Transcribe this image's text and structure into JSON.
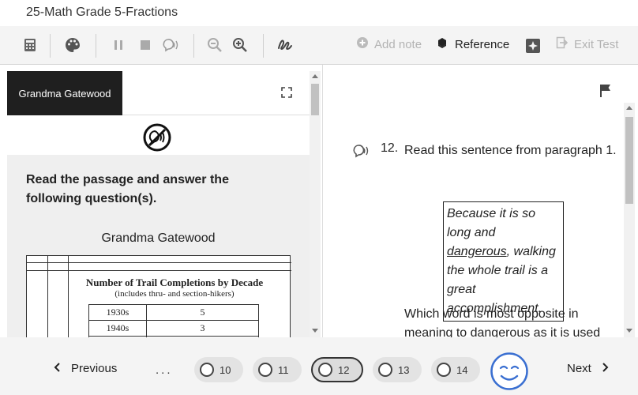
{
  "window": {
    "title": "25-Math Grade 5-Fractions"
  },
  "toolbar": {
    "tools": [
      {
        "name": "calculator-icon"
      },
      {
        "name": "palette-icon"
      },
      {
        "name": "pause-icon"
      },
      {
        "name": "stop-icon"
      },
      {
        "name": "speak-icon"
      },
      {
        "name": "zoom-out-icon"
      },
      {
        "name": "zoom-in-icon"
      },
      {
        "name": "highlighter-icon"
      }
    ],
    "add_note": "Add note",
    "reference": "Reference",
    "exit_test": "Exit Test"
  },
  "passage": {
    "tab_label": "Grandma Gatewood",
    "instruction": "Read the passage and answer the following question(s).",
    "title": "Grandma Gatewood",
    "table": {
      "title": "Number of Trail Completions by Decade",
      "subtitle": "(includes thru- and section-hikers)",
      "rows": [
        {
          "decade": "1930s",
          "count": "5"
        },
        {
          "decade": "1940s",
          "count": "3"
        }
      ]
    }
  },
  "question": {
    "number": "12.",
    "prompt": "Read this sentence from paragraph 1.",
    "quote_before": "Because it is so long and ",
    "quote_underlined": "dangerous",
    "quote_after": ", walking the whole trail is a great accomplishment.",
    "follow_up": "Which word is most opposite in meaning to dangerous as it is used"
  },
  "navigation": {
    "previous": "Previous",
    "next": "Next",
    "ellipsis": "...",
    "pages": [
      {
        "label": "10",
        "current": false
      },
      {
        "label": "11",
        "current": false
      },
      {
        "label": "12",
        "current": true
      },
      {
        "label": "13",
        "current": false
      },
      {
        "label": "14",
        "current": false
      }
    ]
  },
  "colors": {
    "accent": "#3a6fd1",
    "tab_bg": "#1f1f1f",
    "toolbar_bg": "#f4f4f4"
  }
}
